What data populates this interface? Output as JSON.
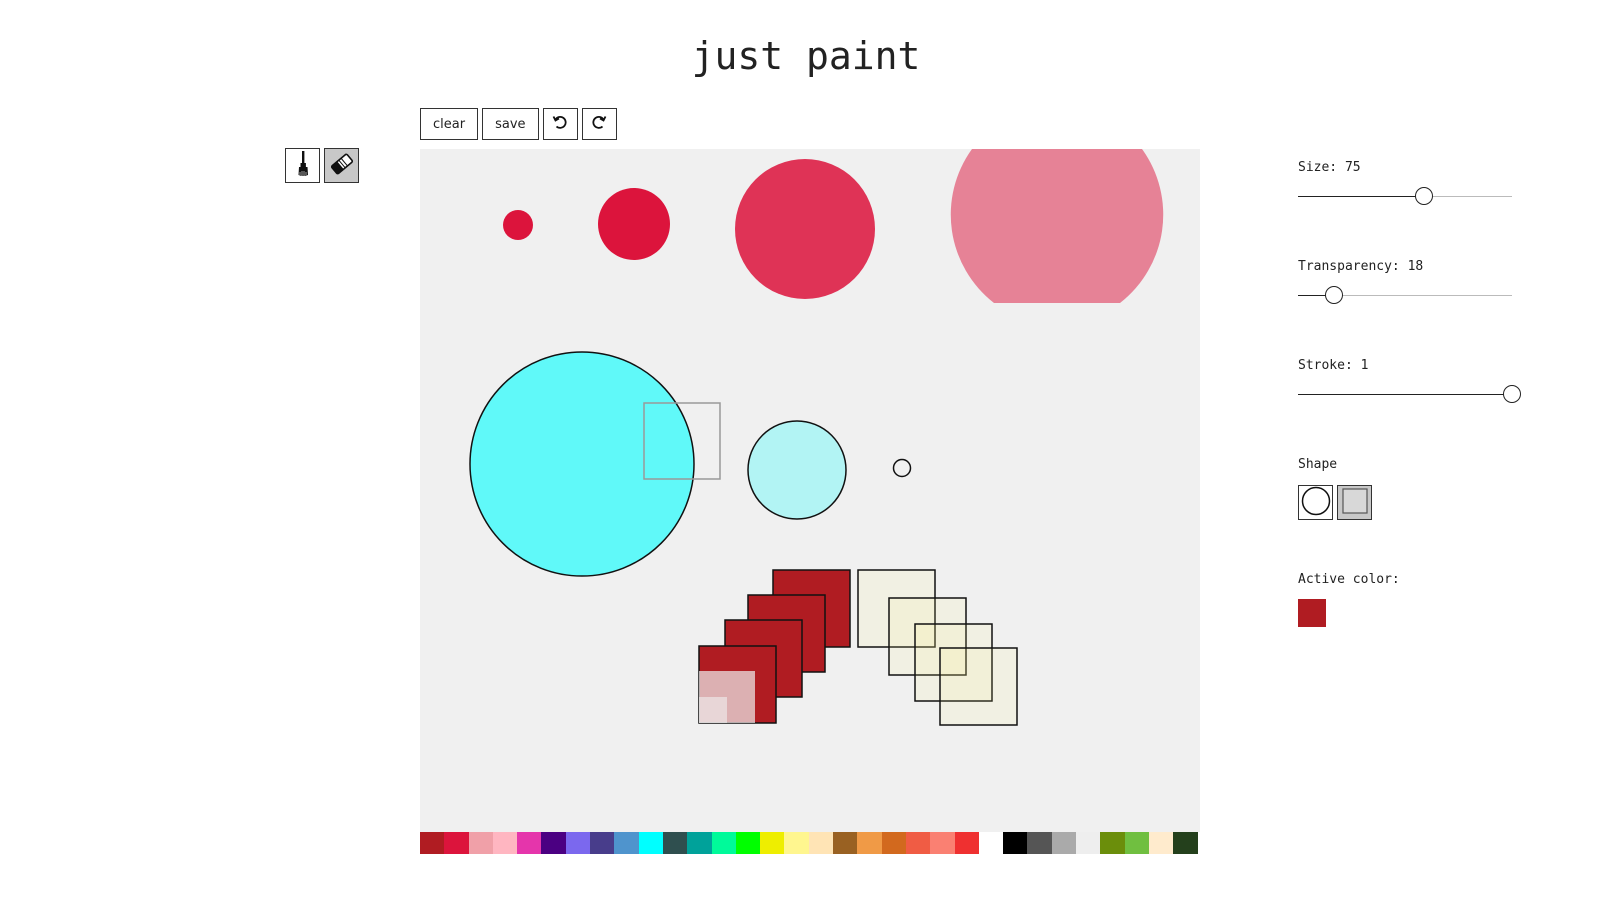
{
  "app": {
    "title": "just paint"
  },
  "toolbar": {
    "clear_label": "clear",
    "save_label": "save",
    "undo_icon": "undo-icon",
    "redo_icon": "redo-icon"
  },
  "tools": {
    "items": [
      {
        "name": "brush",
        "icon": "paintbrush-icon",
        "active": false
      },
      {
        "name": "eraser",
        "icon": "eraser-icon",
        "active": true
      }
    ]
  },
  "controls": {
    "size": {
      "label": "Size: 75",
      "value": 75,
      "fraction": 0.59
    },
    "transparency": {
      "label": "Transparency: 18",
      "value": 18,
      "fraction": 0.17
    },
    "stroke": {
      "label": "Stroke: 1",
      "value": 1,
      "fraction": 1.0
    },
    "shape": {
      "label": "Shape",
      "options": [
        "circle",
        "square"
      ],
      "selected": "square"
    },
    "active_color": {
      "label": "Active color:",
      "color": "#b01c22"
    }
  },
  "palette": {
    "colors": [
      "#b01c22",
      "#dc143c",
      "#f0a0a8",
      "#ffb6c1",
      "#e535ab",
      "#4b0082",
      "#7b68ee",
      "#483d8b",
      "#4f94cd",
      "#00ffff",
      "#2f4f4f",
      "#00a29a",
      "#00fa9a",
      "#00ff00",
      "#eeee00",
      "#fff68f",
      "#ffe4b5",
      "#996122",
      "#f09a46",
      "#d2691e",
      "#f05c44",
      "#fa8072",
      "#ef3030",
      "#ffffff",
      "#000000",
      "#555555",
      "#aaaaaa",
      "#eeeeee",
      "#6b8e0b",
      "#70bf40",
      "#ffebcd",
      "#24401c"
    ]
  },
  "colors": {
    "canvas_bg": "#f0f0f0",
    "button_active": "#c8c8c8",
    "text": "#222222"
  }
}
